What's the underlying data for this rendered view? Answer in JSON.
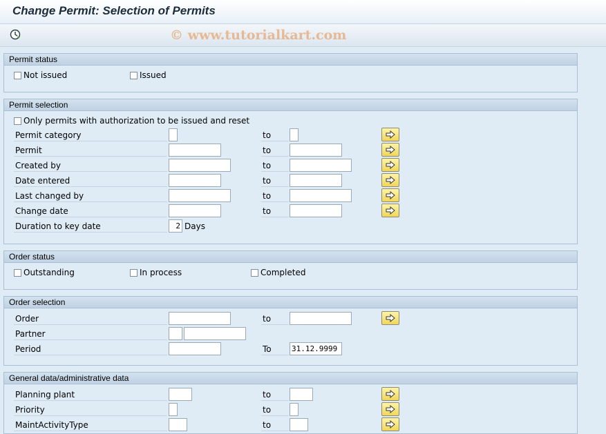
{
  "title": "Change Permit: Selection of Permits",
  "toolbar": {
    "execute_icon": "execute-clock-icon",
    "watermark": "© www.tutorialkart.com"
  },
  "permit_status": {
    "header": "Permit status",
    "not_issued": "Not issued",
    "issued": "Issued"
  },
  "permit_selection": {
    "header": "Permit selection",
    "only_auth": "Only permits with authorization to be issued and reset",
    "to": "to",
    "permit_category": "Permit category",
    "permit": "Permit",
    "created_by": "Created by",
    "date_entered": "Date entered",
    "last_changed_by": "Last changed by",
    "change_date": "Change date",
    "duration": "Duration to key date",
    "duration_value": "2",
    "days": "Days"
  },
  "order_status": {
    "header": "Order status",
    "outstanding": "Outstanding",
    "in_process": "In process",
    "completed": "Completed"
  },
  "order_selection": {
    "header": "Order selection",
    "order": "Order",
    "partner": "Partner",
    "period": "Period",
    "to": "to",
    "period_to": "To",
    "period_to_value": "31.12.9999"
  },
  "general_data": {
    "header": "General data/administrative data",
    "planning_plant": "Planning plant",
    "priority": "Priority",
    "maint_activity_type": "MaintActivityType",
    "to": "to"
  },
  "colors": {
    "background": "#dfebf5",
    "header": "#c9dae8",
    "multi_button": "#f5e07a"
  }
}
